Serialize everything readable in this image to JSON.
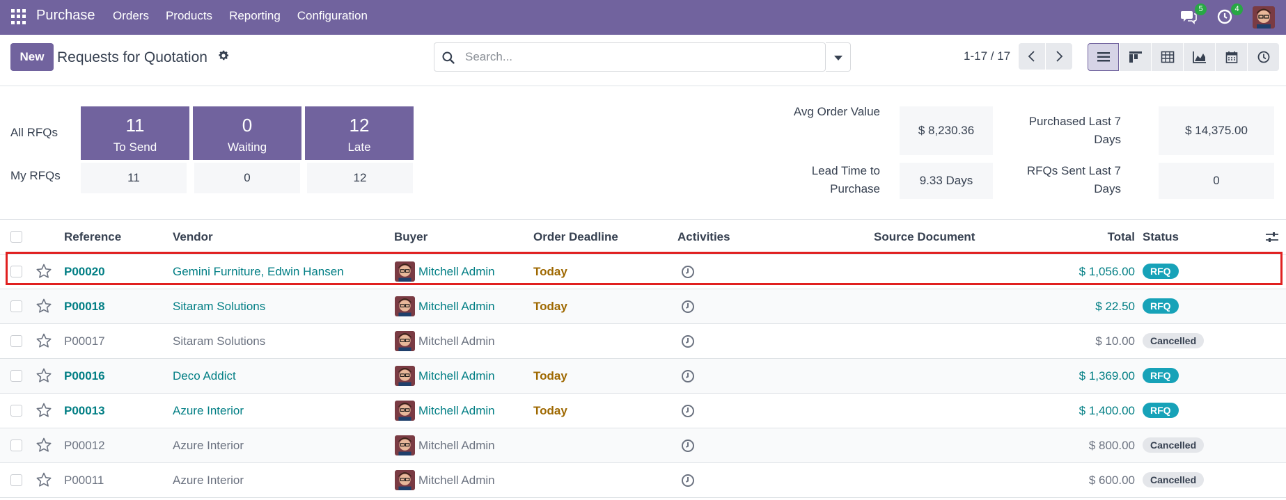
{
  "navbar": {
    "app_name": "Purchase",
    "menu": [
      "Orders",
      "Products",
      "Reporting",
      "Configuration"
    ],
    "messages_count": "5",
    "activities_count": "4",
    "color": "#71639e"
  },
  "control": {
    "new_label": "New",
    "title": "Requests for Quotation",
    "search_placeholder": "Search...",
    "pager": "1-17 / 17",
    "views": [
      "list-icon",
      "kanban-icon",
      "pivot-icon",
      "graph-icon",
      "calendar-icon",
      "activity-icon"
    ]
  },
  "dashboard": {
    "all_label": "All RFQs",
    "my_label": "My RFQs",
    "tiles": [
      {
        "value": "11",
        "label": "To Send",
        "mine": "11"
      },
      {
        "value": "0",
        "label": "Waiting",
        "mine": "0"
      },
      {
        "value": "12",
        "label": "Late",
        "mine": "12"
      }
    ],
    "kpis": {
      "avg_order_label": "Avg Order Value",
      "avg_order_value": "$ 8,230.36",
      "purchased_label_1": "Purchased Last 7",
      "purchased_label_2": "Days",
      "purchased_value": "$ 14,375.00",
      "lead_label_1": "Lead Time to",
      "lead_label_2": "Purchase",
      "lead_value": "9.33 Days",
      "sent_label_1": "RFQs Sent Last 7",
      "sent_label_2": "Days",
      "sent_value": "0"
    }
  },
  "table": {
    "headers": {
      "reference": "Reference",
      "vendor": "Vendor",
      "buyer": "Buyer",
      "deadline": "Order Deadline",
      "activities": "Activities",
      "source": "Source Document",
      "total": "Total",
      "status": "Status"
    },
    "rows": [
      {
        "ref": "P00020",
        "vendor": "Gemini Furniture, Edwin Hansen",
        "buyer": "Mitchell Admin",
        "deadline": "Today",
        "total": "$ 1,056.00",
        "status": "RFQ"
      },
      {
        "ref": "P00018",
        "vendor": "Sitaram Solutions",
        "buyer": "Mitchell Admin",
        "deadline": "Today",
        "total": "$ 22.50",
        "status": "RFQ"
      },
      {
        "ref": "P00017",
        "vendor": "Sitaram Solutions",
        "buyer": "Mitchell Admin",
        "deadline": "",
        "total": "$ 10.00",
        "status": "Cancelled"
      },
      {
        "ref": "P00016",
        "vendor": "Deco Addict",
        "buyer": "Mitchell Admin",
        "deadline": "Today",
        "total": "$ 1,369.00",
        "status": "RFQ"
      },
      {
        "ref": "P00013",
        "vendor": "Azure Interior",
        "buyer": "Mitchell Admin",
        "deadline": "Today",
        "total": "$ 1,400.00",
        "status": "RFQ"
      },
      {
        "ref": "P00012",
        "vendor": "Azure Interior",
        "buyer": "Mitchell Admin",
        "deadline": "",
        "total": "$ 800.00",
        "status": "Cancelled"
      },
      {
        "ref": "P00011",
        "vendor": "Azure Interior",
        "buyer": "Mitchell Admin",
        "deadline": "",
        "total": "$ 600.00",
        "status": "Cancelled"
      }
    ]
  }
}
